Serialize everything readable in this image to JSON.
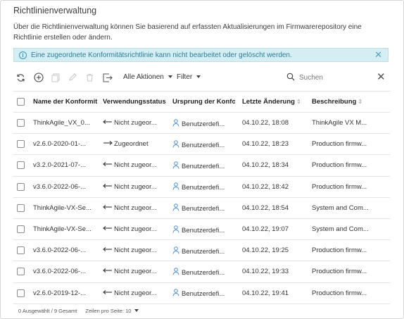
{
  "page": {
    "title": "Richtlinienverwaltung",
    "description": "Über die Richtlinienverwaltung können Sie basierend auf erfassten Aktualisierungen im Firmwarerepository eine Richtlinie erstellen oder ändern."
  },
  "notice": {
    "text": "Eine zugeordnete Konformitätsrichtlinie kann nicht bearbeitet oder gelöscht werden.",
    "close": "✕"
  },
  "toolbar": {
    "all_actions": "Alle Aktionen",
    "filter": "Filter",
    "search_placeholder": "Suchen",
    "clear": "✕"
  },
  "table": {
    "columns": [
      "Name der Konformit",
      "Verwendungsstatus",
      "Ursprung der Konfor",
      "Letzte Änderung",
      "Beschreibung"
    ],
    "rows": [
      {
        "name": "ThinkAgile_VX_0...",
        "status": "Nicht zugeor...",
        "origin": "Benutzerdefi...",
        "changed": "04.10.22, 18:08",
        "desc": "ThinkAgile VX M..."
      },
      {
        "name": "v2.6.0-2020-01-...",
        "status": "Zugeordnet",
        "origin": "Benutzerdefi...",
        "changed": "04.10.22, 18:23",
        "desc": "Production firmw..."
      },
      {
        "name": "v3.2.0-2021-07-...",
        "status": "Nicht zugeor...",
        "origin": "Benutzerdefi...",
        "changed": "04.10.22, 18:34",
        "desc": "Production firmw..."
      },
      {
        "name": "v3.6.0-2022-06-...",
        "status": "Nicht zugeor...",
        "origin": "Benutzerdefi...",
        "changed": "04.10.22, 18:42",
        "desc": "Production firmw..."
      },
      {
        "name": "ThinkAgile-VX-Se...",
        "status": "Nicht zugeor...",
        "origin": "Benutzerdefi...",
        "changed": "04.10.22, 18:54",
        "desc": "System and Com..."
      },
      {
        "name": "ThinkAgile-VX-Se...",
        "status": "Nicht zugeor...",
        "origin": "Benutzerdefi...",
        "changed": "04.10.22, 19:07",
        "desc": "System and Com..."
      },
      {
        "name": "v3.6.0-2022-06-...",
        "status": "Nicht zugeor...",
        "origin": "Benutzerdefi...",
        "changed": "04.10.22, 19:25",
        "desc": "Production firmw..."
      },
      {
        "name": "v3.6.0-2022-06-...",
        "status": "Nicht zugeor...",
        "origin": "Benutzerdefi...",
        "changed": "04.10.22, 19:33",
        "desc": "Production firmw..."
      },
      {
        "name": "v2.6.0-2019-12-...",
        "status": "Nicht zugeor...",
        "origin": "Benutzerdefi...",
        "changed": "04.10.22, 19:41",
        "desc": "Production firmw..."
      }
    ]
  },
  "footer": {
    "selection": "0 Ausgewählt / 9 Gesamt",
    "per_page": "Zeilen pro Seite: 10"
  },
  "colors": {
    "notice_bg": "#d5eef4",
    "notice_text": "#2a7f98",
    "person_icon": "#4b8fd6"
  }
}
